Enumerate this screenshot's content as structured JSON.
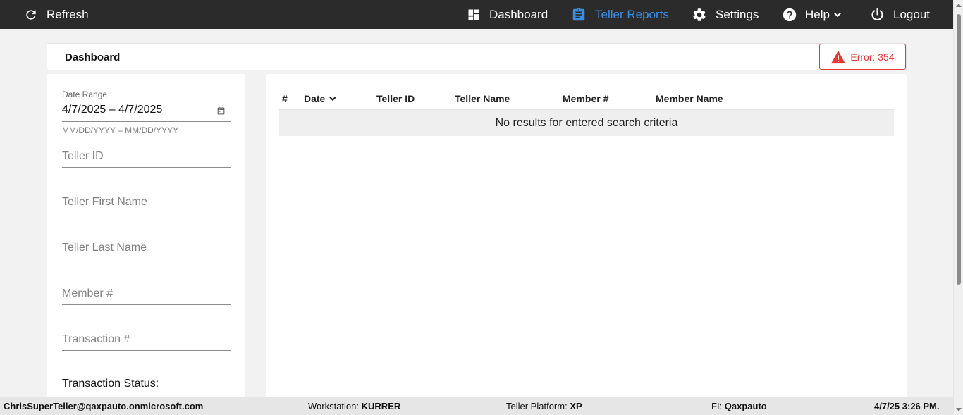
{
  "topbar": {
    "refresh_label": "Refresh",
    "nav": {
      "dashboard": "Dashboard",
      "teller_reports": "Teller Reports",
      "settings": "Settings",
      "help": "Help",
      "logout": "Logout"
    },
    "active_color": "#3a8ee6",
    "bg_color": "#2b2b2b"
  },
  "header": {
    "title": "Dashboard",
    "error_label": "Error: 354",
    "error_color": "#e53935"
  },
  "filters": {
    "date_range_label": "Date Range",
    "date_range_value": "4/7/2025 – 4/7/2025",
    "date_hint": "MM/DD/YYYY – MM/DD/YYYY",
    "teller_id_placeholder": "Teller ID",
    "teller_first_name_placeholder": "Teller First Name",
    "teller_last_name_placeholder": "Teller Last Name",
    "member_placeholder": "Member #",
    "transaction_placeholder": "Transaction #",
    "transaction_status_label": "Transaction Status:"
  },
  "table": {
    "columns": [
      "#",
      "Date",
      "Teller ID",
      "Teller Name",
      "Member #",
      "Member Name"
    ],
    "empty_message": "No results for entered search criteria"
  },
  "footer": {
    "user": "ChrisSuperTeller@qaxpauto.onmicrosoft.com",
    "workstation_label": "Workstation:",
    "workstation_value": "KURRER",
    "platform_label": "Teller Platform:",
    "platform_value": "XP",
    "fi_label": "FI:",
    "fi_value": "Qaxpauto",
    "datetime": "4/7/25 3:26 PM."
  }
}
